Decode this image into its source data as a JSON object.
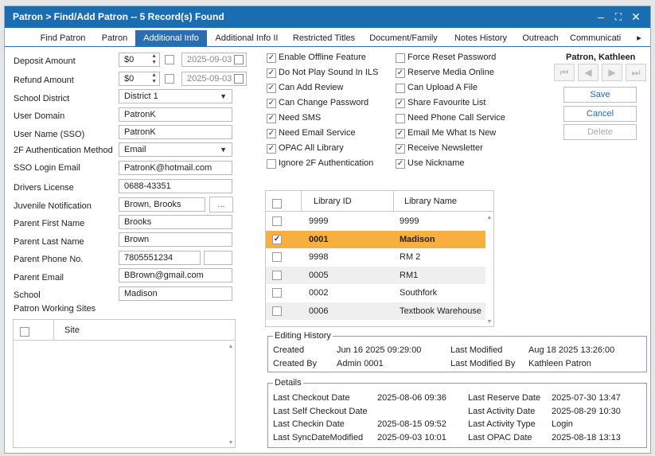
{
  "window": {
    "title": "Patron > Find/Add Patron -- 5 Record(s) Found",
    "minimize": "–",
    "maximize": "⛶",
    "close": "✕"
  },
  "tabs": [
    "Find Patron",
    "Patron",
    "Additional Info",
    "Additional Info II",
    "Restricted Titles",
    "Document/Family",
    "Notes History",
    "Outreach",
    "Communicati",
    "▸"
  ],
  "form": {
    "deposit_amount": {
      "label": "Deposit Amount",
      "value": "$0",
      "date": "2025-09-03"
    },
    "refund_amount": {
      "label": "Refund Amount",
      "value": "$0",
      "date": "2025-09-03"
    },
    "school_district": {
      "label": "School District",
      "value": "District 1"
    },
    "user_domain": {
      "label": "User Domain",
      "value": "PatronK"
    },
    "user_name_sso": {
      "label": "User Name (SSO)",
      "value": "PatronK"
    },
    "two_factor": {
      "label": "2F Authentication Method",
      "value": "Email"
    },
    "sso_email": {
      "label": "SSO Login Email",
      "value": "PatronK@hotmail.com"
    },
    "drivers_license": {
      "label": "Drivers License",
      "value": "0688-43351"
    },
    "juvenile": {
      "label": "Juvenile Notification",
      "value": "Brown, Brooks",
      "button": "..."
    },
    "parent_first": {
      "label": "Parent First Name",
      "value": "Brooks"
    },
    "parent_last": {
      "label": "Parent Last Name",
      "value": "Brown"
    },
    "parent_phone": {
      "label": "Parent Phone No.",
      "value": "7805551234",
      "ext": ""
    },
    "parent_email": {
      "label": "Parent Email",
      "value": "BBrown@gmail.com"
    },
    "school": {
      "label": "School",
      "value": "Madison"
    },
    "working_sites": {
      "label": "Patron Working Sites",
      "column": "Site"
    }
  },
  "options_left": [
    {
      "label": "Enable Offline Feature",
      "checked": true
    },
    {
      "label": "Do Not Play Sound In ILS",
      "checked": true
    },
    {
      "label": "Can Add Review",
      "checked": true
    },
    {
      "label": "Can Change Password",
      "checked": true
    },
    {
      "label": "Need SMS",
      "checked": true
    },
    {
      "label": "Need Email Service",
      "checked": true
    },
    {
      "label": "OPAC All Library",
      "checked": true
    },
    {
      "label": "Ignore 2F Authentication",
      "checked": false
    }
  ],
  "options_right": [
    {
      "label": "Force Reset Password",
      "checked": false
    },
    {
      "label": "Reserve Media Online",
      "checked": true
    },
    {
      "label": "Can Upload A File",
      "checked": false
    },
    {
      "label": "Share Favourite List",
      "checked": true
    },
    {
      "label": "Need Phone Call Service",
      "checked": false
    },
    {
      "label": "Email Me What Is New",
      "checked": true
    },
    {
      "label": "Receive Newsletter",
      "checked": true
    },
    {
      "label": "Use Nickname",
      "checked": true
    }
  ],
  "library_grid": {
    "headers": [
      "Library ID",
      "Library Name"
    ],
    "rows": [
      {
        "id": "9999",
        "name": "9999",
        "checked": false
      },
      {
        "id": "0001",
        "name": "Madison",
        "checked": true
      },
      {
        "id": "9998",
        "name": "RM 2",
        "checked": false
      },
      {
        "id": "0005",
        "name": "RM1",
        "checked": false
      },
      {
        "id": "0002",
        "name": "Southfork",
        "checked": false
      },
      {
        "id": "0006",
        "name": "Textbook Warehouse",
        "checked": false
      }
    ],
    "selected_color": "#f7b040"
  },
  "patron_name": "Patron, Kathleen",
  "nav_icons": [
    "first-record-icon",
    "prev-record-icon",
    "next-record-icon",
    "last-record-icon"
  ],
  "nav_glyphs": [
    "⏮",
    "◀",
    "▶",
    "⏭"
  ],
  "buttons": {
    "save": "Save",
    "cancel": "Cancel",
    "delete": "Delete"
  },
  "editing_history": {
    "title": "Editing History",
    "created_label": "Created",
    "created": "Jun 16 2025 09:29:00",
    "modified_label": "Last Modified",
    "modified": "Aug 18 2025 13:26:00",
    "created_by_label": "Created By",
    "created_by": "Admin 0001",
    "modified_by_label": "Last Modified By",
    "modified_by": "Kathleen Patron"
  },
  "details": {
    "title": "Details",
    "items": [
      {
        "label": "Last Checkout Date",
        "value": "2025-08-06 09:36"
      },
      {
        "label": "Last Reserve Date",
        "value": "2025-07-30 13:47"
      },
      {
        "label": "Last Self Checkout Date",
        "value": ""
      },
      {
        "label": "Last Activity Date",
        "value": "2025-08-29 10:30"
      },
      {
        "label": "Last Checkin Date",
        "value": "2025-08-15 09:52"
      },
      {
        "label": "Last Activity Type",
        "value": "Login"
      },
      {
        "label": "Last SyncDateModified",
        "value": "2025-09-03 10:01"
      },
      {
        "label": "Last OPAC Date",
        "value": "2025-08-18 13:13"
      }
    ]
  },
  "colors": {
    "titlebar": "#1b6db1",
    "accent": "#2a6db0"
  }
}
